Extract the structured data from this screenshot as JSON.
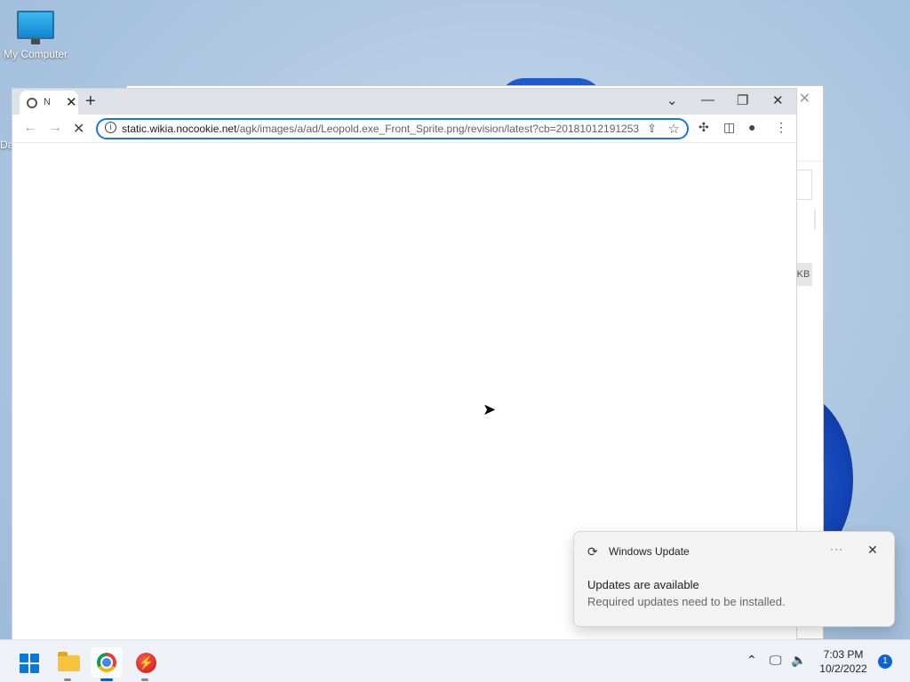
{
  "desktop": {
    "icons": [
      {
        "label": "My Computer"
      }
    ],
    "partial_label": "Da"
  },
  "background_window": {
    "close_glyph": "✕",
    "kb_label": "KB"
  },
  "browser": {
    "tab": {
      "title": "N",
      "close_glyph": "✕"
    },
    "new_tab_glyph": "+",
    "window_controls": {
      "tab_search": "⌄",
      "minimize": "—",
      "restore": "❐",
      "close": "✕"
    },
    "nav": {
      "back": "←",
      "forward": "→",
      "stop": "✕"
    },
    "address_bar": {
      "host": "static.wikia.nocookie.net",
      "path": "/agk/images/a/ad/Leopold.exe_Front_Sprite.png/revision/latest?cb=20181012191253"
    },
    "toolbar_icons": [
      "share-icon",
      "star-icon",
      "extensions-icon",
      "side-panel-icon",
      "profile-icon",
      "menu-icon"
    ]
  },
  "notification": {
    "app": "Windows Update",
    "more_glyph": "···",
    "close_glyph": "✕",
    "title": "Updates are available",
    "body": "Required updates need to be installed."
  },
  "taskbar": {
    "apps": [
      "start",
      "file-explorer",
      "chrome",
      "flash-app"
    ],
    "clock": {
      "time": "7:03 PM",
      "date": "10/2/2022"
    },
    "notification_count": "1",
    "tray_icons": [
      "chevron-up-icon",
      "network-icon",
      "volume-icon"
    ]
  },
  "colors": {
    "accent": "#1a73e8",
    "taskbar": "#eef2f6",
    "badge": "#0a64d6"
  }
}
